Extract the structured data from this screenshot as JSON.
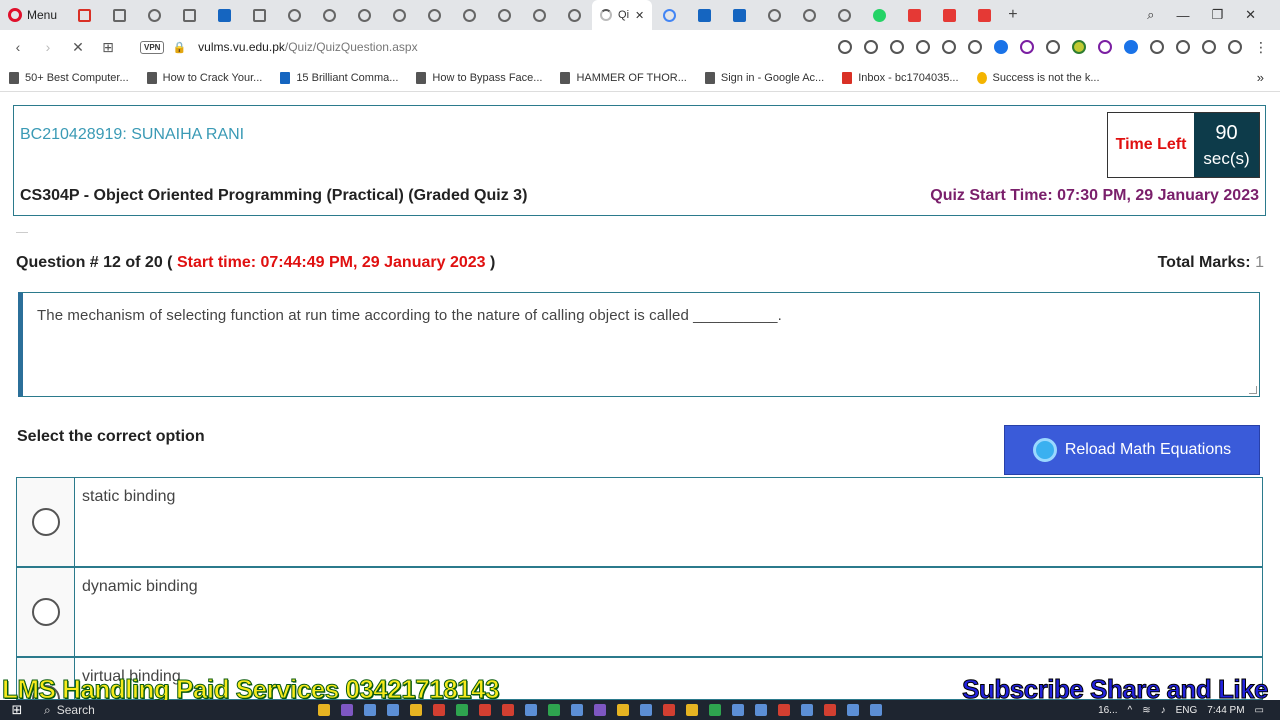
{
  "browser": {
    "menu_label": "Menu",
    "active_tab_title": "Qi",
    "url_host": "vulms.vu.edu.pk",
    "url_path": "/Quiz/QuizQuestion.aspx",
    "vpn_label": "VPN",
    "bookmarks": [
      "50+ Best Computer...",
      "How to Crack Your...",
      "15 Brilliant Comma...",
      "How to Bypass Face...",
      "HAMMER OF THOR...",
      "Sign in - Google Ac...",
      "Inbox - bc1704035...",
      "Success is not the k..."
    ]
  },
  "quiz": {
    "student": "BC210428919: SUNAIHA RANI",
    "course": "CS304P - Object Oriented Programming (Practical) (Graded Quiz 3)",
    "quiz_start": "Quiz Start Time: 07:30 PM, 29 January 2023",
    "timer_label": "Time Left",
    "timer_value": "90",
    "timer_unit": "sec(s)",
    "question_number": "Question # 12 of 20 (",
    "start_time": "Start time: 07:44:49 PM, 29 January 2023",
    "question_close": ")",
    "total_marks_label": "Total Marks:",
    "total_marks_value": "1",
    "question_text": "The mechanism of selecting function at run time according to the nature of calling object is called __________.",
    "select_label": "Select the correct option",
    "reload_label": "Reload Math Equations",
    "options": [
      "static binding",
      "dynamic binding",
      "virtual binding"
    ]
  },
  "overlay": {
    "left": "LMS Handling Paid Services 03421718143",
    "right": "Subscribe Share and Like"
  },
  "taskbar": {
    "search_label": "Search",
    "tray_weather": "16...",
    "tray_lang": "ENG",
    "tray_time": "7:44 PM"
  }
}
